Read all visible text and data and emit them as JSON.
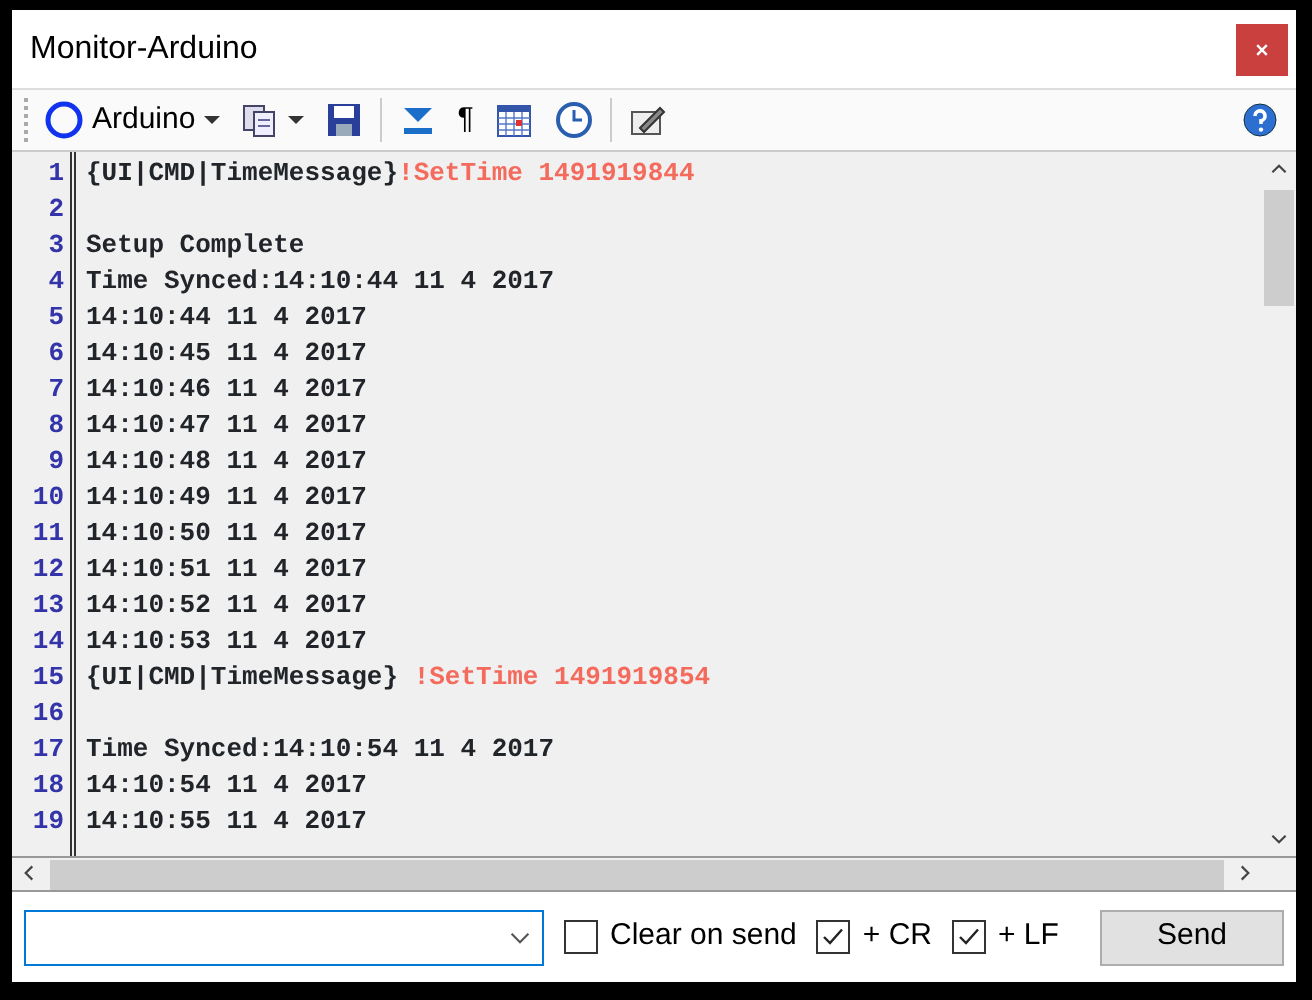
{
  "window": {
    "title": "Monitor-Arduino"
  },
  "toolbar": {
    "port": "Arduino",
    "items": [
      {
        "kind": "copy"
      },
      {
        "kind": "save"
      },
      {
        "kind": "scroll"
      },
      {
        "kind": "pilcrow",
        "text": "¶"
      },
      {
        "kind": "calendar"
      },
      {
        "kind": "clock"
      },
      {
        "kind": "edit"
      }
    ]
  },
  "lines": [
    {
      "number": "1",
      "parts": [
        {
          "text": "{UI|CMD|TimeMessage}",
          "kind": "plain"
        },
        {
          "text": "!SetTime 1491919844",
          "kind": "command"
        }
      ]
    },
    {
      "number": "2"
    },
    {
      "number": "3",
      "parts": [
        {
          "text": "Setup Complete",
          "kind": "plain"
        }
      ]
    },
    {
      "number": "4",
      "parts": [
        {
          "text": "Time Synced:14:10:44 11 4 2017",
          "kind": "plain"
        }
      ]
    },
    {
      "number": "5",
      "parts": [
        {
          "text": "14:10:44 11 4 2017",
          "kind": "plain"
        }
      ]
    },
    {
      "number": "6",
      "parts": [
        {
          "text": "14:10:45 11 4 2017",
          "kind": "plain"
        }
      ]
    },
    {
      "number": "7",
      "parts": [
        {
          "text": "14:10:46 11 4 2017",
          "kind": "plain"
        }
      ]
    },
    {
      "number": "8",
      "parts": [
        {
          "text": "14:10:47 11 4 2017",
          "kind": "plain"
        }
      ]
    },
    {
      "number": "9",
      "parts": [
        {
          "text": "14:10:48 11 4 2017",
          "kind": "plain"
        }
      ]
    },
    {
      "number": "10",
      "parts": [
        {
          "text": "14:10:49 11 4 2017",
          "kind": "plain"
        }
      ]
    },
    {
      "number": "11",
      "parts": [
        {
          "text": "14:10:50 11 4 2017",
          "kind": "plain"
        }
      ]
    },
    {
      "number": "12",
      "parts": [
        {
          "text": "14:10:51 11 4 2017",
          "kind": "plain"
        }
      ]
    },
    {
      "number": "13",
      "parts": [
        {
          "text": "14:10:52 11 4 2017",
          "kind": "plain"
        }
      ]
    },
    {
      "number": "14",
      "parts": [
        {
          "text": "14:10:53 11 4 2017",
          "kind": "plain"
        }
      ]
    },
    {
      "number": "15",
      "parts": [
        {
          "text": "{UI|CMD|TimeMessage} ",
          "kind": "plain"
        },
        {
          "text": "!SetTime 1491919854",
          "kind": "command"
        }
      ]
    },
    {
      "number": "16"
    },
    {
      "number": "17",
      "parts": [
        {
          "text": "Time Synced:14:10:54 11 4 2017",
          "kind": "plain"
        }
      ]
    },
    {
      "number": "18",
      "parts": [
        {
          "text": "14:10:54 11 4 2017",
          "kind": "plain"
        }
      ]
    },
    {
      "number": "19",
      "parts": [
        {
          "text": "14:10:55 11 4 2017",
          "kind": "plain"
        }
      ]
    }
  ],
  "options": [
    {
      "label": "Clear on send",
      "checked": false
    },
    {
      "label": "+ CR",
      "checked": true
    },
    {
      "label": "+ LF",
      "checked": true
    }
  ],
  "send_button": "Send"
}
